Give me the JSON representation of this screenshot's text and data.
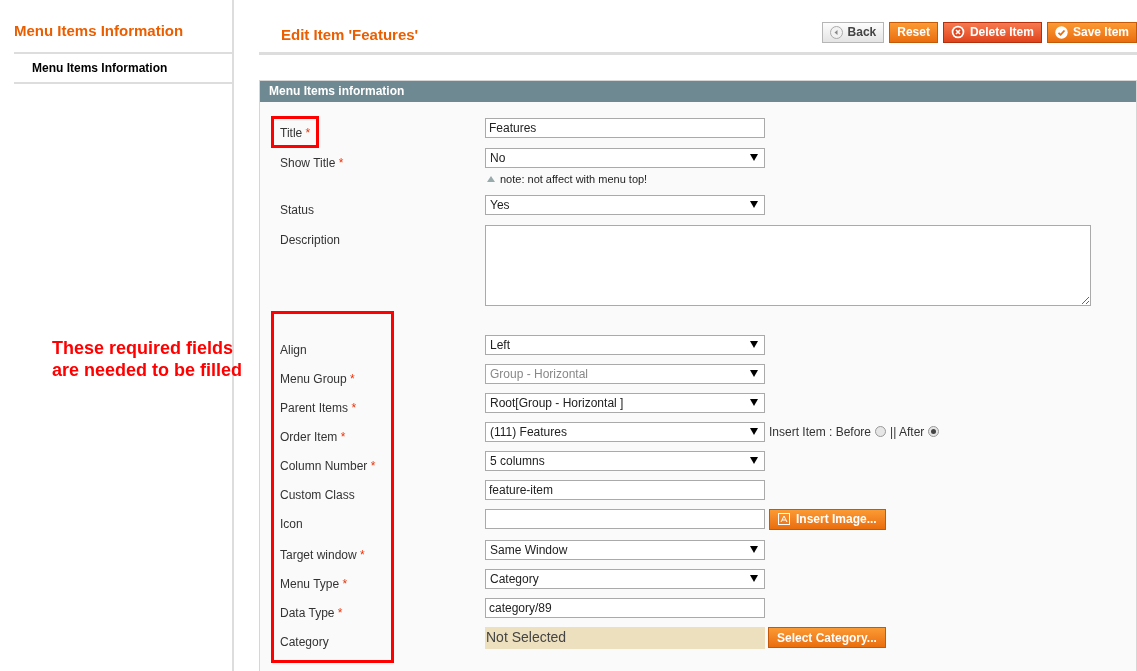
{
  "sidebar": {
    "title": "Menu Items Information",
    "items": [
      {
        "label": "Menu Items Information",
        "selected": true
      }
    ]
  },
  "header": {
    "title": "Edit Item 'Features'",
    "buttons": [
      {
        "label": "Back",
        "kind": "back"
      },
      {
        "label": "Reset",
        "kind": "plain"
      },
      {
        "label": "Delete Item",
        "kind": "delete"
      },
      {
        "label": "Save Item",
        "kind": "save"
      }
    ]
  },
  "panel": {
    "title": "Menu Items information",
    "fields": [
      {
        "label": "Title",
        "required_mark": "*",
        "highlighted": true,
        "kind": "text",
        "value": "Features"
      },
      {
        "label": "Show Title",
        "required_mark": "*",
        "kind": "select",
        "value": "No",
        "note": "note: not affect with menu top!"
      },
      {
        "label": "Status",
        "kind": "select",
        "value": "Yes"
      },
      {
        "label": "Description",
        "kind": "textarea"
      }
    ],
    "required_group": {
      "highlighted": true,
      "annotation": [
        "These required fields",
        "are needed to be filled"
      ],
      "fields": [
        {
          "label": "Align",
          "kind": "select",
          "value": "Left"
        },
        {
          "label": "Menu Group",
          "required_mark": "*",
          "kind": "select",
          "value": "Group - Horizontal",
          "disabled": true
        },
        {
          "label": "Parent Items",
          "required_mark": "*",
          "kind": "select",
          "value": "Root[Group - Horizontal ]"
        },
        {
          "label": "Order Item",
          "required_mark": "*",
          "kind": "order",
          "value": "(111) Features",
          "insert_label": "Insert Item : Before",
          "before_selected": false,
          "options": [
            {
              "label": "|| After",
              "selected": true
            }
          ]
        },
        {
          "label": "Column Number",
          "required_mark": "*",
          "kind": "select",
          "value": "5 columns"
        },
        {
          "label": "Custom Class",
          "kind": "text",
          "value": "feature-item"
        },
        {
          "label": "Icon",
          "kind": "image",
          "button": "Insert Image..."
        },
        {
          "label": "Target window",
          "required_mark": "*",
          "kind": "select",
          "value": "Same Window"
        },
        {
          "label": "Menu Type",
          "required_mark": "*",
          "kind": "select",
          "value": "Category"
        },
        {
          "label": "Data Type",
          "required_mark": "*",
          "kind": "text",
          "value": "category/89"
        },
        {
          "label": "Category",
          "kind": "category",
          "value": "Not Selected",
          "button": "Select Category..."
        }
      ]
    }
  }
}
